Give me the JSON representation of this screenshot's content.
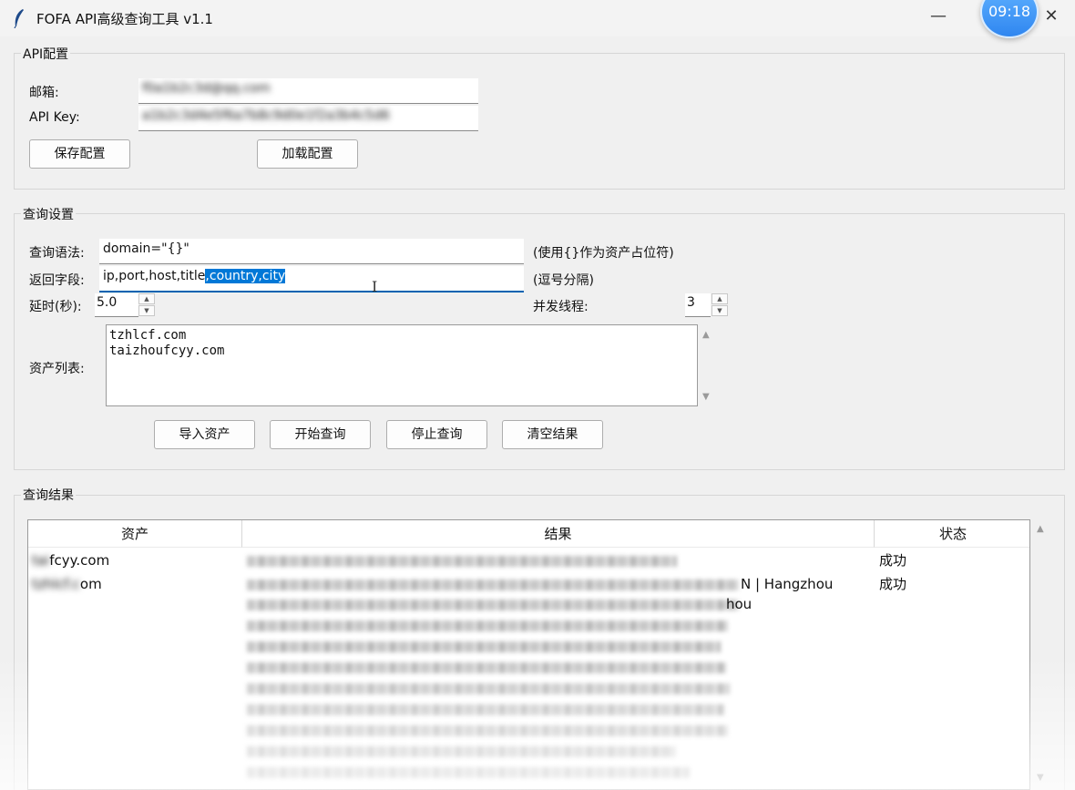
{
  "window": {
    "title": "FOFA API高级查询工具 v1.1",
    "minimize_glyph": "—",
    "close_glyph": "✕",
    "clock": "09:18"
  },
  "api_config": {
    "group_title": "API配置",
    "email_label": "邮箱:",
    "email_value": "f0a1b2c3d@qq.com",
    "apikey_label": "API Key:",
    "apikey_value": "a1b2c3d4e5f6a7b8c9d0e1f2a3b4c5d6",
    "save_button": "保存配置",
    "load_button": "加载配置"
  },
  "query_settings": {
    "group_title": "查询设置",
    "syntax_label": "查询语法:",
    "syntax_value": "domain=\"{}\"",
    "syntax_hint": "(使用{}作为资产占位符)",
    "fields_label": "返回字段:",
    "fields_value_plain": "ip,port,host,title",
    "fields_value_selected": ",country,city",
    "fields_hint": "(逗号分隔)",
    "delay_label": "延时(秒):",
    "delay_value": "5.0",
    "threads_label": "并发线程:",
    "threads_value": "3",
    "assets_label": "资产列表:",
    "assets": [
      "tzhlcf.com",
      "taizhoufcyy.com"
    ],
    "buttons": {
      "import": "导入资产",
      "start": "开始查询",
      "stop": "停止查询",
      "clear": "清空结果"
    }
  },
  "results": {
    "group_title": "查询结果",
    "columns": [
      "资产",
      "结果",
      "状态"
    ],
    "rows": [
      {
        "asset_hidden": "tai",
        "asset_visible": "fcyy.com",
        "result_visible": "",
        "status": "成功"
      },
      {
        "asset_hidden": "tzhlcf.c",
        "asset_visible": "om",
        "result_visible": "N | Hangzhou",
        "status": "成功"
      }
    ],
    "continued_line": "hou"
  },
  "icons": {
    "app": "feather-icon",
    "spin_up": "▲",
    "spin_down": "▼"
  },
  "colors": {
    "selection": "#0078d7",
    "focus_underline": "#0063b1"
  }
}
